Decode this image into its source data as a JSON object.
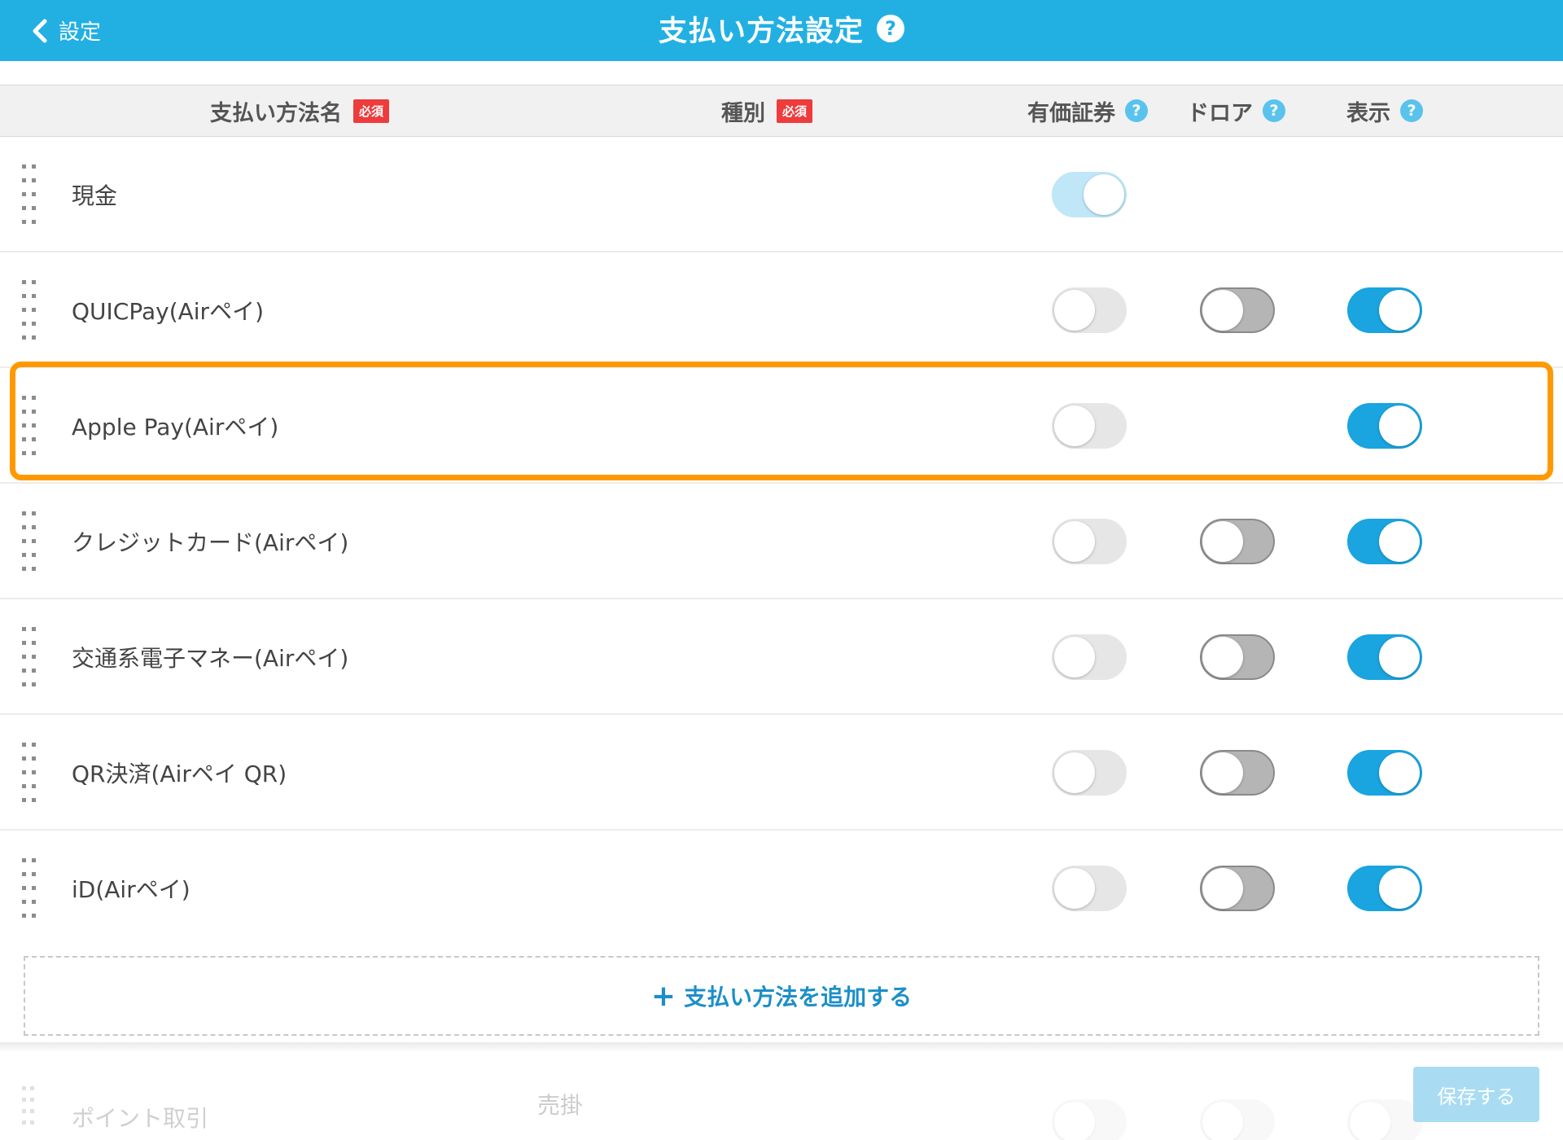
{
  "header": {
    "back_label": "設定",
    "title": "支払い方法設定",
    "help": "?"
  },
  "columns": {
    "name": "支払い方法名",
    "type": "種別",
    "required": "必須",
    "securities": "有価証券",
    "drawer": "ドロア",
    "display": "表示",
    "help": "?"
  },
  "rows": [
    {
      "name": "現金",
      "securities": "on-disabled",
      "drawer": "none",
      "display": "none"
    },
    {
      "name": "QUICPay(Airペイ)",
      "securities": "off",
      "drawer": "off-gray",
      "display": "on"
    },
    {
      "name": "Apple Pay(Airペイ)",
      "securities": "off",
      "drawer": "none",
      "display": "on"
    },
    {
      "name": "クレジットカード(Airペイ)",
      "securities": "off",
      "drawer": "off-gray",
      "display": "on"
    },
    {
      "name": "交通系電子マネー(Airペイ)",
      "securities": "off",
      "drawer": "off-gray",
      "display": "on"
    },
    {
      "name": "QR決済(Airペイ QR)",
      "securities": "off",
      "drawer": "off-gray",
      "display": "on"
    },
    {
      "name": "iD(Airペイ)",
      "securities": "off",
      "drawer": "off-gray",
      "display": "on"
    }
  ],
  "add_button": {
    "plus": "+",
    "label": "支払い方法を追加する"
  },
  "faded_row": {
    "name": "ポイント取引",
    "type": "売掛"
  },
  "save_button": "保存する",
  "colors": {
    "header": "#22b0e3",
    "toggle_on": "#1aa4e0",
    "highlight": "#ff9900",
    "required_badge": "#ee3b3b"
  }
}
